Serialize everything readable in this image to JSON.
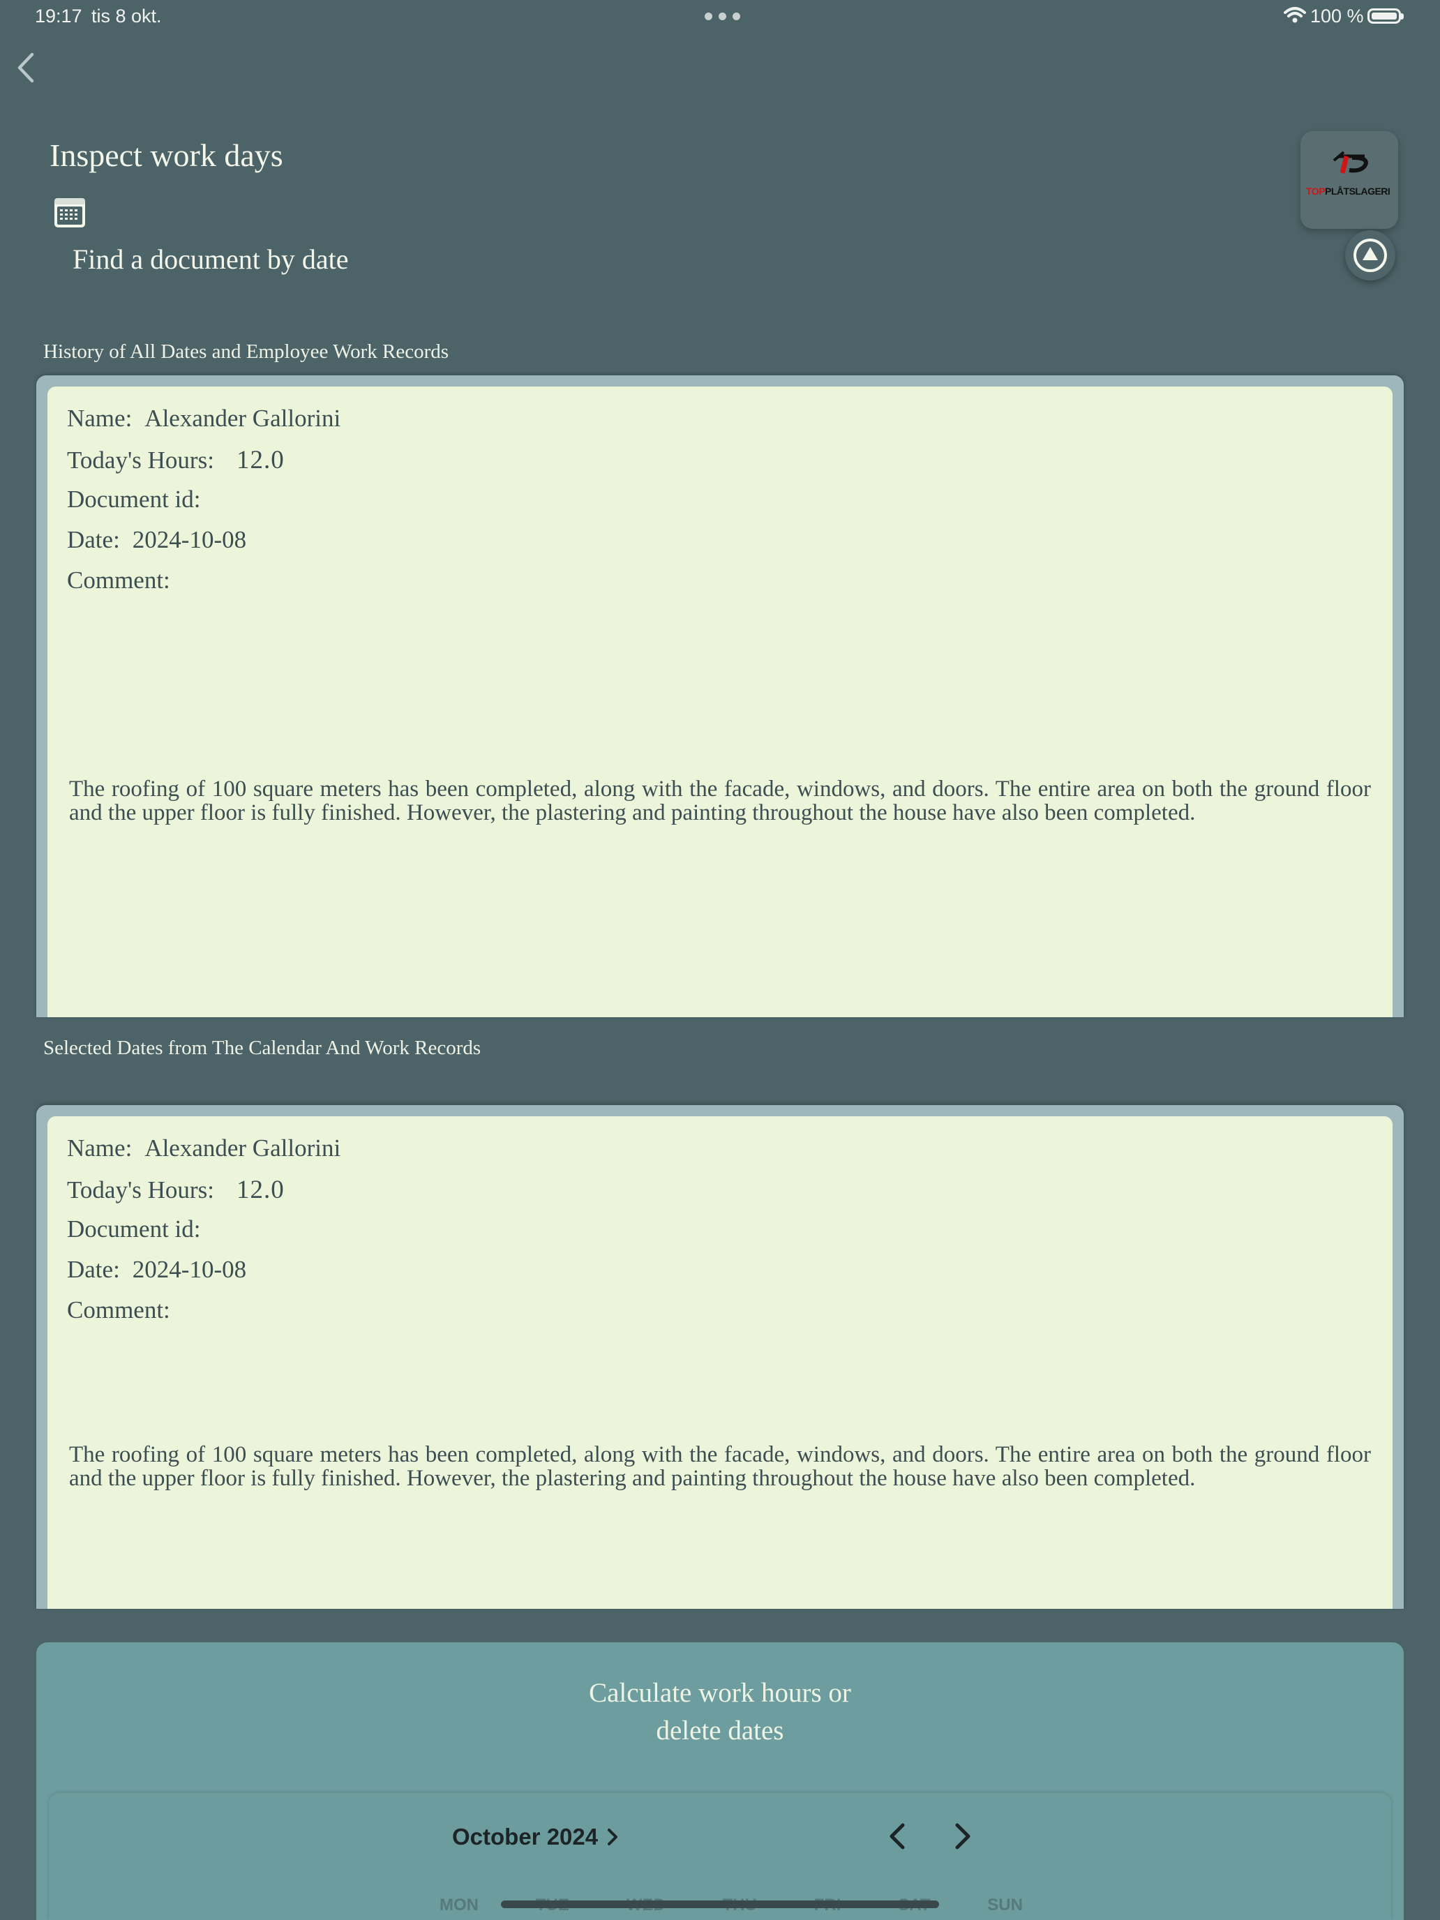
{
  "status_bar": {
    "time": "19:17",
    "date": "tis 8 okt.",
    "battery": "100 %"
  },
  "header": {
    "title": "Inspect work days",
    "find_document": "Find a document by date",
    "logo_text_top": "TOP",
    "logo_text": "PLÅTSLAGERI"
  },
  "history_section": {
    "label": "History of All Dates and Employee Work Records",
    "record": {
      "name_label": "Name:",
      "name": "Alexander Gallorini",
      "hours_label": "Today's Hours:",
      "hours": "12.0",
      "doc_id_label": "Document id:",
      "doc_id": "",
      "date_label": "Date:",
      "date": "2024-10-08",
      "comment_label": "Comment:",
      "comment": "The roofing of 100 square meters has been completed, along with the facade, windows, and doors. The entire area on both the ground floor and the upper floor is fully finished. However, the plastering and painting throughout the house have also been completed."
    }
  },
  "selected_section": {
    "label": "Selected Dates from The Calendar And Work Records",
    "record": {
      "name_label": "Name:",
      "name": "Alexander Gallorini",
      "hours_label": "Today's Hours:",
      "hours": "12.0",
      "doc_id_label": "Document id:",
      "doc_id": "",
      "date_label": "Date:",
      "date": "2024-10-08",
      "comment_label": "Comment:",
      "comment": "The roofing of 100 square meters has been completed, along with the facade, windows, and doors. The entire area on both the ground floor and the upper floor is fully finished. However, the plastering and painting throughout the house have also been completed."
    }
  },
  "calculate_panel": {
    "title_line1": "Calculate work hours or",
    "title_line2": "delete dates",
    "calendar": {
      "month": "October 2024",
      "weekdays": [
        "MON",
        "TUE",
        "WED",
        "THU",
        "FRI",
        "SAT",
        "SUN"
      ]
    }
  },
  "colors": {
    "background": "#4c6367",
    "card": "#ecf5da",
    "panel": "#6e9d9f"
  }
}
